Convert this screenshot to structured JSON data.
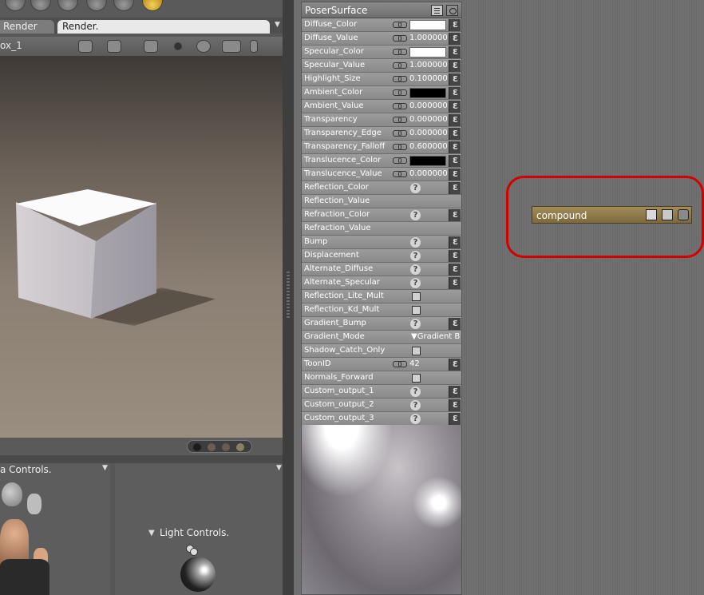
{
  "app": {
    "tabs": [
      "Render",
      "Render."
    ],
    "camera_name": "ox_1",
    "panels": {
      "left_subpanel_title": "a Controls.",
      "light_controls_title": "Light Controls."
    }
  },
  "poser_surface": {
    "title": "PoserSurface",
    "rows": [
      {
        "label": "Diffuse_Color",
        "kind": "color",
        "color": "#ffffff"
      },
      {
        "label": "Diffuse_Value",
        "kind": "number",
        "value": "1.000000"
      },
      {
        "label": "Specular_Color",
        "kind": "color",
        "color": "#ffffff"
      },
      {
        "label": "Specular_Value",
        "kind": "number",
        "value": "1.000000"
      },
      {
        "label": "Highlight_Size",
        "kind": "number",
        "value": "0.100000"
      },
      {
        "label": "Ambient_Color",
        "kind": "color",
        "color": "#000000"
      },
      {
        "label": "Ambient_Value",
        "kind": "number",
        "value": "0.000000"
      },
      {
        "label": "Transparency",
        "kind": "number",
        "value": "0.000000"
      },
      {
        "label": "Transparency_Edge",
        "kind": "number",
        "value": "0.000000"
      },
      {
        "label": "Transparency_Falloff",
        "kind": "number",
        "value": "0.600000"
      },
      {
        "label": "Translucence_Color",
        "kind": "color",
        "color": "#000000"
      },
      {
        "label": "Translucence_Value",
        "kind": "number",
        "value": "0.000000"
      },
      {
        "label": "Reflection_Color",
        "kind": "q"
      },
      {
        "label": "Reflection_Value",
        "kind": "plain"
      },
      {
        "label": "Refraction_Color",
        "kind": "q"
      },
      {
        "label": "Refraction_Value",
        "kind": "plain"
      },
      {
        "label": "Bump",
        "kind": "q"
      },
      {
        "label": "Displacement",
        "kind": "q"
      },
      {
        "label": "Alternate_Diffuse",
        "kind": "q"
      },
      {
        "label": "Alternate_Specular",
        "kind": "q"
      },
      {
        "label": "Reflection_Lite_Mult",
        "kind": "checkbox"
      },
      {
        "label": "Reflection_Kd_Mult",
        "kind": "checkbox"
      },
      {
        "label": "Gradient_Bump",
        "kind": "q"
      },
      {
        "label": "Gradient_Mode",
        "kind": "mode",
        "value": "Gradient B"
      },
      {
        "label": "Shadow_Catch_Only",
        "kind": "checkbox"
      },
      {
        "label": "ToonID",
        "kind": "number",
        "value": "42"
      },
      {
        "label": "Normals_Forward",
        "kind": "checkbox"
      },
      {
        "label": "Custom_output_1",
        "kind": "q"
      },
      {
        "label": "Custom_output_2",
        "kind": "q"
      },
      {
        "label": "Custom_output_3",
        "kind": "q"
      }
    ]
  },
  "compound_node": {
    "title": "compound",
    "highlight_color": "#d40000"
  },
  "glyphs": {
    "question": "?",
    "plug": "Ɛ",
    "dropdown": "▼",
    "panel_menu": "▼"
  },
  "colors": {
    "node_body": "#8f8f8f",
    "compound_header": "#8c7848",
    "grid": "#707070"
  }
}
